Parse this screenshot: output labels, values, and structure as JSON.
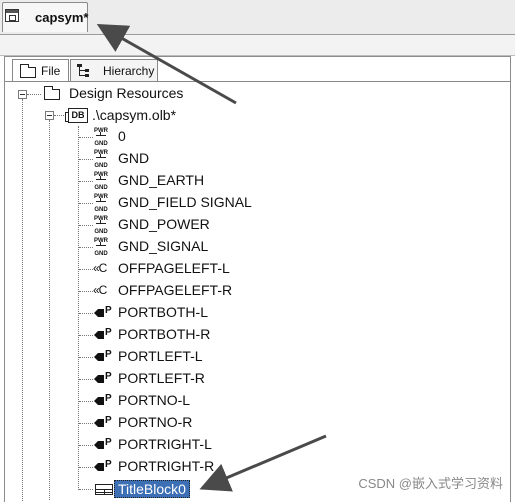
{
  "document_tab": {
    "title": "capsym*",
    "icon": "window-icon"
  },
  "panel_tabs": [
    {
      "label": "File",
      "icon": "folder-icon"
    },
    {
      "label": "Hierarchy",
      "icon": "hierarchy-icon"
    }
  ],
  "tree": {
    "root": {
      "label": "Design Resources",
      "icon": "folder-icon"
    },
    "library": {
      "label": ".\\capsym.olb*",
      "icon": "library-icon",
      "icon_text": "DB"
    },
    "items": [
      {
        "label": "0",
        "icon": "power-icon"
      },
      {
        "label": "GND",
        "icon": "power-icon"
      },
      {
        "label": "GND_EARTH",
        "icon": "power-icon"
      },
      {
        "label": "GND_FIELD SIGNAL",
        "icon": "power-icon"
      },
      {
        "label": "GND_POWER",
        "icon": "power-icon"
      },
      {
        "label": "GND_SIGNAL",
        "icon": "power-icon"
      },
      {
        "label": "OFFPAGELEFT-L",
        "icon": "offpage-icon"
      },
      {
        "label": "OFFPAGELEFT-R",
        "icon": "offpage-icon"
      },
      {
        "label": "PORTBOTH-L",
        "icon": "port-icon"
      },
      {
        "label": "PORTBOTH-R",
        "icon": "port-icon"
      },
      {
        "label": "PORTLEFT-L",
        "icon": "port-icon"
      },
      {
        "label": "PORTLEFT-R",
        "icon": "port-icon"
      },
      {
        "label": "PORTNO-L",
        "icon": "port-icon"
      },
      {
        "label": "PORTNO-R",
        "icon": "port-icon"
      },
      {
        "label": "PORTRIGHT-L",
        "icon": "port-icon"
      },
      {
        "label": "PORTRIGHT-R",
        "icon": "port-icon"
      },
      {
        "label": "TitleBlock0",
        "icon": "titleblock-icon",
        "selected": true
      }
    ]
  },
  "icon_text": {
    "power_top": "PWR",
    "power_bottom": "GND",
    "offpage": "«C",
    "port": "P"
  },
  "watermark": "CSDN @嵌入式学习资料",
  "colors": {
    "selection": "#3d6fb5",
    "arrow": "#4a4a4a"
  }
}
